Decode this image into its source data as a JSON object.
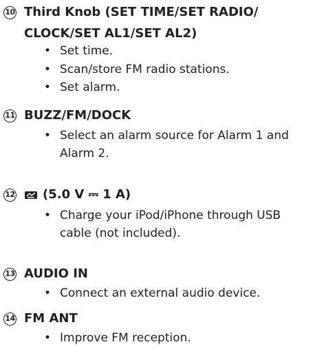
{
  "sections": [
    {
      "number": "10",
      "heading_lines": [
        "Third Knob (SET TIME/SET RADIO/",
        "CLOCK/SET AL1/SET AL2)"
      ],
      "bullets": [
        [
          "Set time."
        ],
        [
          "Scan/store FM radio stations."
        ],
        [
          "Set alarm."
        ]
      ]
    },
    {
      "number": "11",
      "heading_lines": [
        "BUZZ/FM/DOCK"
      ],
      "bullets": [
        [
          "Select an alarm source for Alarm 1 and",
          "Alarm 2."
        ]
      ]
    },
    {
      "number": "12",
      "icon": "usb-power-icon",
      "heading_lines": [
        "(5.0 V ⎓ 1 A)"
      ],
      "bullets": [
        [
          "Charge your iPod/iPhone through USB",
          "cable (not included)."
        ]
      ]
    },
    {
      "number": "13",
      "heading_lines": [
        "AUDIO IN"
      ],
      "bullets": [
        [
          "Connect an external audio device."
        ]
      ]
    },
    {
      "number": "14",
      "heading_lines": [
        "FM ANT"
      ],
      "bullets": [
        [
          "Improve FM reception."
        ]
      ]
    }
  ],
  "bullet_char": "•"
}
